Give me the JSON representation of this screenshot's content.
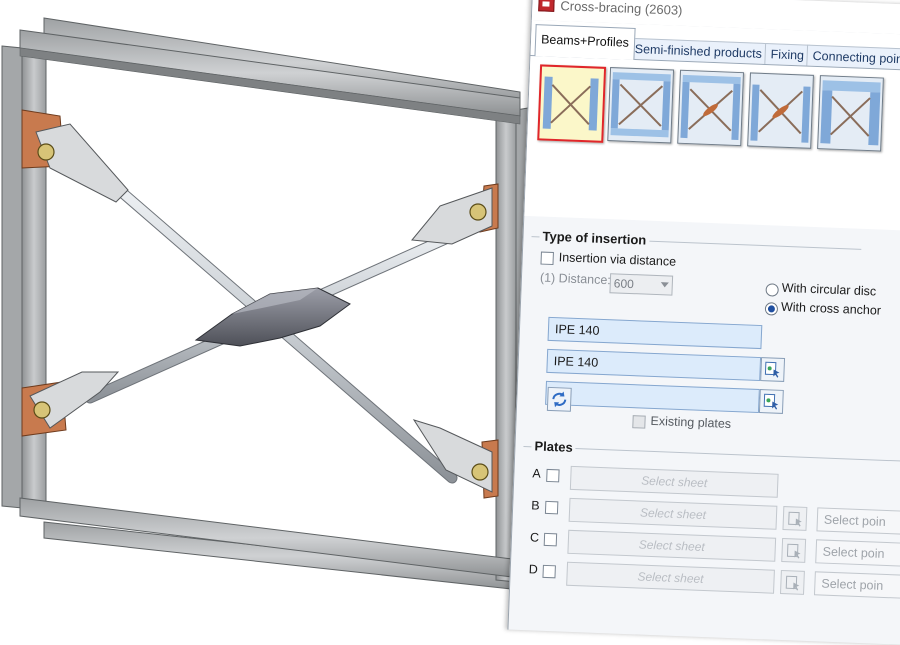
{
  "dialog": {
    "title": "Cross-bracing (2603)",
    "tabs": [
      {
        "label": "Beams+Profiles",
        "active": true
      },
      {
        "label": "Semi-finished products",
        "active": false
      },
      {
        "label": "Fixing",
        "active": false
      },
      {
        "label": "Connecting poin",
        "active": false
      }
    ],
    "variants": [
      {
        "name": "variant-1",
        "selected": true
      },
      {
        "name": "variant-2",
        "selected": false
      },
      {
        "name": "variant-3",
        "selected": false
      },
      {
        "name": "variant-4",
        "selected": false
      },
      {
        "name": "variant-5",
        "selected": false
      }
    ],
    "insertion": {
      "title": "Type of insertion",
      "via_distance_label": "Insertion via distance",
      "via_distance_checked": false,
      "distance_label": "(1) Distance:",
      "distance_value": "600",
      "circular_disc_label": "With circular disc",
      "cross_anchor_label": "With cross anchor",
      "selected": "cross_anchor"
    },
    "profiles": [
      "IPE 140",
      "IPE 140"
    ],
    "existing_plates_label": "Existing plates",
    "plates": {
      "title": "Plates",
      "rows": [
        {
          "letter": "A",
          "sheet_placeholder": "Select sheet",
          "point_placeholder": ""
        },
        {
          "letter": "B",
          "sheet_placeholder": "Select sheet",
          "point_placeholder": "Select poin"
        },
        {
          "letter": "C",
          "sheet_placeholder": "Select sheet",
          "point_placeholder": "Select poin"
        },
        {
          "letter": "D",
          "sheet_placeholder": "Select sheet",
          "point_placeholder": "Select poin"
        }
      ]
    }
  },
  "colors": {
    "accent": "#1f4fa0",
    "selection_border": "#e0262b",
    "field_blue": "#dcebfb",
    "gusset": "#c87a4e",
    "steel": "#b3b5b7"
  }
}
